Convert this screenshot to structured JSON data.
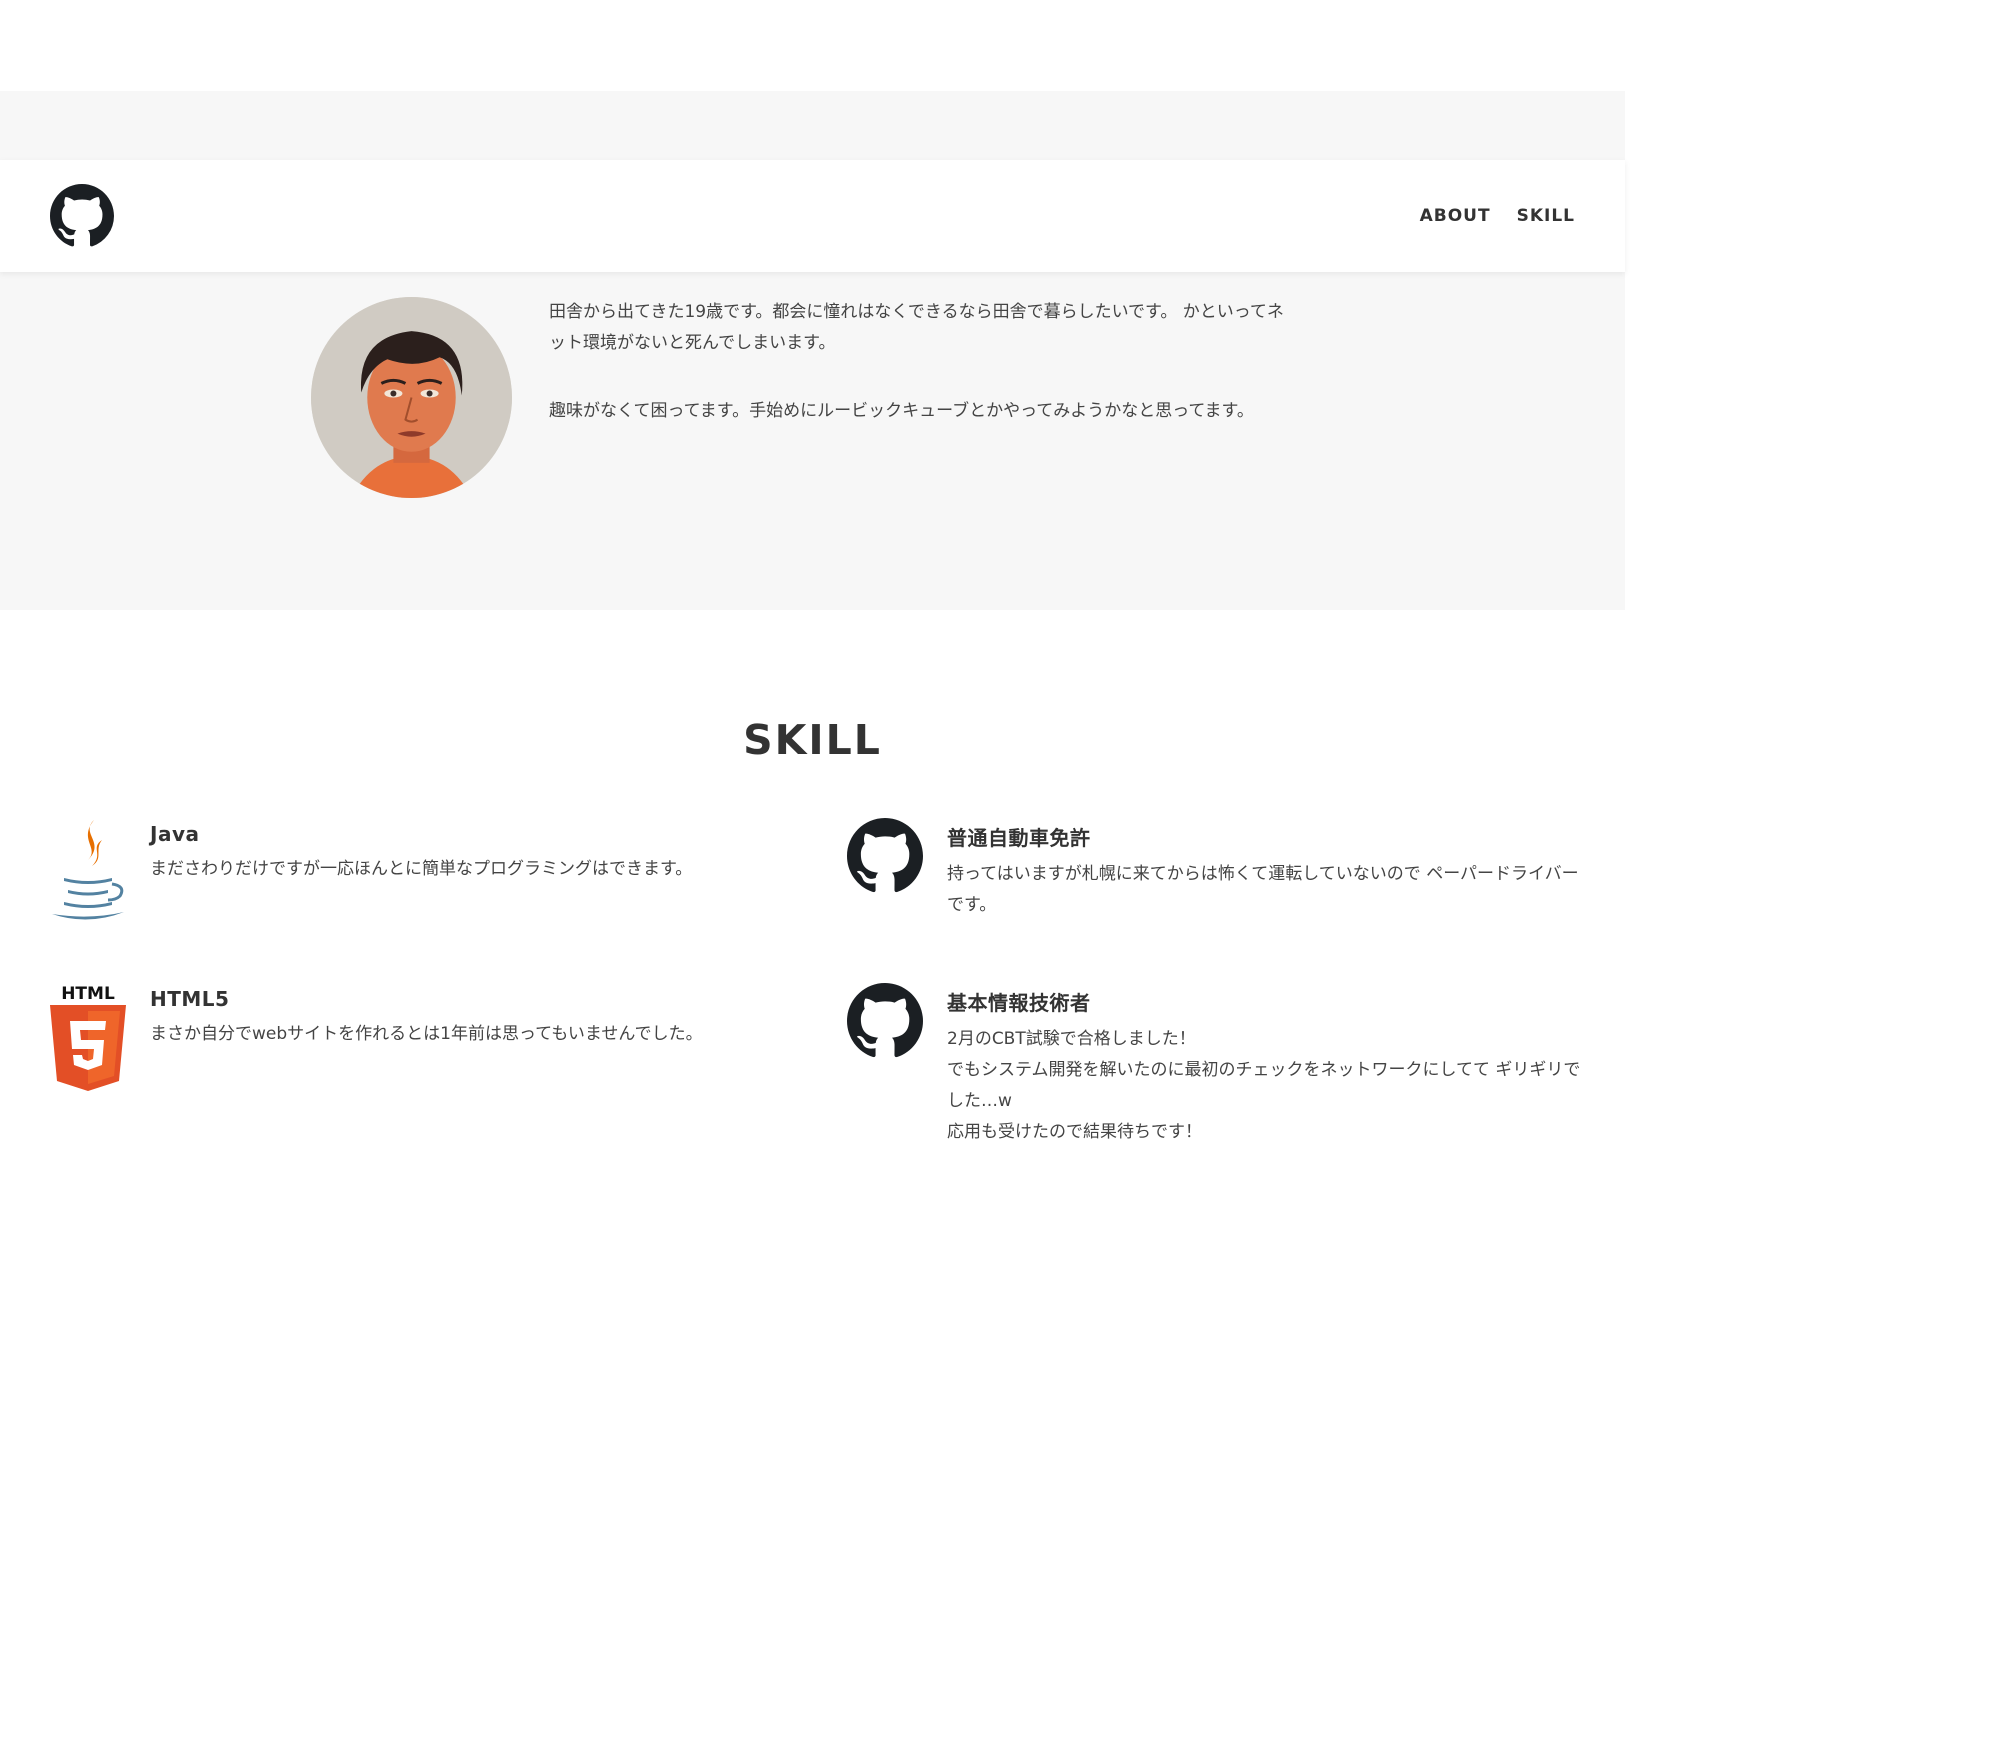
{
  "header": {
    "logo_icon": "github-octocat-icon",
    "nav": [
      {
        "label": "ABOUT"
      },
      {
        "label": "SKILL"
      }
    ]
  },
  "about": {
    "avatar": "portrait-avatar",
    "paragraphs": [
      "田舎から出てきた19歳です。都会に憧れはなくできるなら田舎で暮らしたいです。 かといってネット環境がないと死んでしまいます。",
      "趣味がなくて困ってます。手始めにルービックキューブとかやってみようかなと思ってます。"
    ]
  },
  "skill": {
    "title": "SKILL",
    "items": [
      {
        "icon": "java-icon",
        "name": "Java",
        "desc_lines": [
          "まださわりだけですが一応ほんとに簡単なプログラミングはできます。"
        ]
      },
      {
        "icon": "github-octocat-icon",
        "name": "普通自動車免許",
        "desc_lines": [
          "持ってはいますが札幌に来てからは怖くて運転していないので ペーパードライバーです。"
        ]
      },
      {
        "icon": "html5-icon",
        "icon_label": "HTML",
        "name": "HTML5",
        "desc_lines": [
          "まさか自分でwebサイトを作れるとは1年前は思ってもいませんでした。"
        ]
      },
      {
        "icon": "github-octocat-icon",
        "name": "基本情報技術者",
        "desc_lines": [
          "2月のCBT試験で合格しました！",
          "でもシステム開発を解いたのに最初のチェックをネットワークにしてて ギリギリでした…w",
          "応用も受けたので結果待ちです！"
        ]
      }
    ]
  },
  "colors": {
    "text": "#333333",
    "section_bg": "#f7f7f7",
    "java_orange": "#e76f00",
    "java_blue": "#5382a1",
    "html5_orange": "#e34f26"
  }
}
